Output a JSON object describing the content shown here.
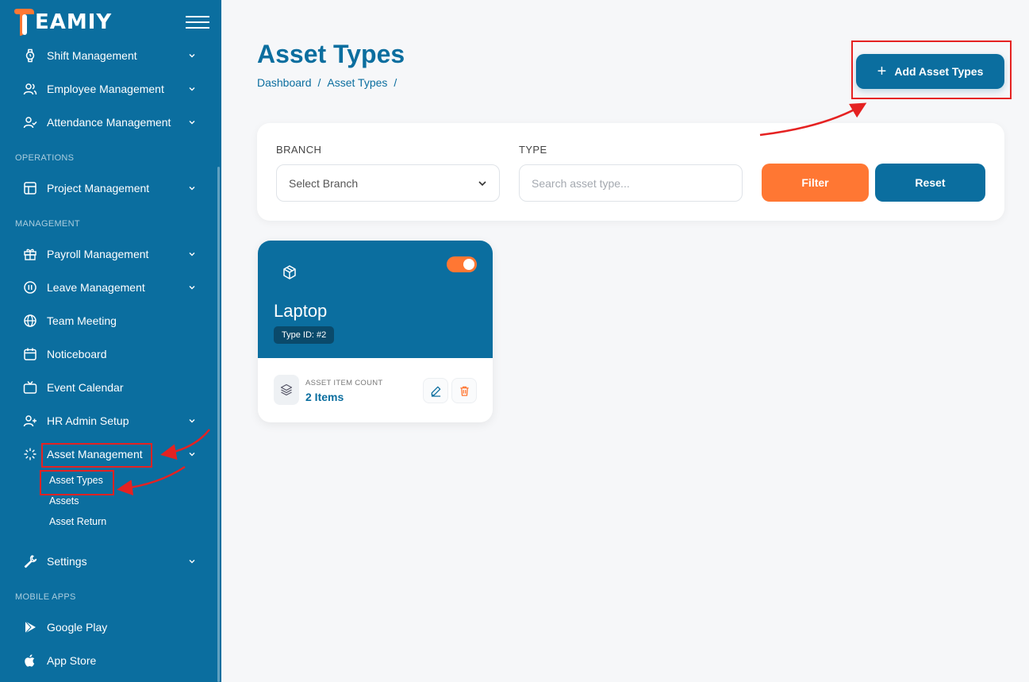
{
  "brand": {
    "name": "EAMIY",
    "primary_color": "#0b6e9f",
    "accent_color": "#ff7733"
  },
  "sidebar": {
    "items_top": [
      {
        "label": "Shift Management",
        "icon": "watch-icon"
      },
      {
        "label": "Employee Management",
        "icon": "users-icon"
      },
      {
        "label": "Attendance Management",
        "icon": "user-check-icon"
      }
    ],
    "sections": {
      "operations": "OPERATIONS",
      "management": "MANAGEMENT",
      "mobile_apps": "MOBILE APPS"
    },
    "operations_items": [
      {
        "label": "Project Management",
        "icon": "layout-icon"
      }
    ],
    "management_items": [
      {
        "label": "Payroll Management",
        "icon": "gift-icon"
      },
      {
        "label": "Leave Management",
        "icon": "pause-circle-icon"
      },
      {
        "label": "Team Meeting",
        "icon": "globe-icon"
      },
      {
        "label": "Noticeboard",
        "icon": "calendar-icon"
      },
      {
        "label": "Event Calendar",
        "icon": "tv-icon"
      },
      {
        "label": "HR Admin Setup",
        "icon": "user-plus-icon"
      },
      {
        "label": "Asset Management",
        "icon": "loader-icon"
      }
    ],
    "asset_sub_items": [
      "Asset Types",
      "Assets",
      "Asset Return"
    ],
    "settings": {
      "label": "Settings",
      "icon": "wrench-icon"
    },
    "mobile_items": [
      {
        "label": "Google Play",
        "icon": "play-icon"
      },
      {
        "label": "App Store",
        "icon": "apple-icon"
      }
    ]
  },
  "header": {
    "title": "Asset Types",
    "breadcrumb": [
      "Dashboard",
      "Asset Types"
    ],
    "add_button": "Add Asset Types"
  },
  "filters": {
    "branch_label": "BRANCH",
    "branch_value": "Select Branch",
    "type_label": "TYPE",
    "type_placeholder": "Search asset type...",
    "filter_button": "Filter",
    "reset_button": "Reset"
  },
  "cards": [
    {
      "name": "Laptop",
      "type_id": "Type ID: #2",
      "enabled": true,
      "count_label": "ASSET ITEM COUNT",
      "count_value": "2 Items"
    }
  ]
}
